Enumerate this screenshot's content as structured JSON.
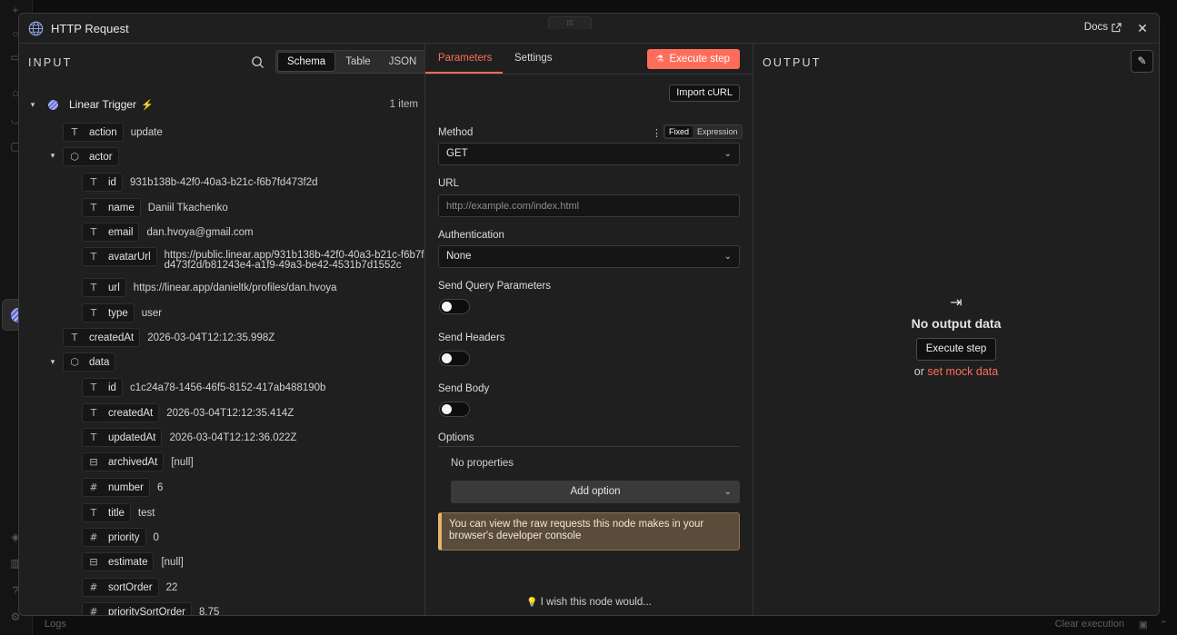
{
  "modal": {
    "title": "HTTP Request",
    "docs_label": "Docs"
  },
  "input": {
    "title": "INPUT",
    "view_tabs": [
      "Schema",
      "Table",
      "JSON"
    ],
    "trigger": {
      "label": "Linear Trigger",
      "count": "1 item"
    },
    "rows": [
      {
        "key": "action",
        "value": "update"
      },
      {
        "key": "actor"
      },
      {
        "key": "id",
        "value": "931b138b-42f0-40a3-b21c-f6b7fd473f2d"
      },
      {
        "key": "name",
        "value": "Daniil Tkachenko"
      },
      {
        "key": "email",
        "value": "dan.hvoya@gmail.com"
      },
      {
        "key": "avatarUrl",
        "value": "https://public.linear.app/931b138b-42f0-40a3-b21c-f6b7fd473f2d/b81243e4-a1f9-49a3-be42-4531b7d1552c"
      },
      {
        "key": "url",
        "value": "https://linear.app/danieltk/profiles/dan.hvoya"
      },
      {
        "key": "type",
        "value": "user"
      },
      {
        "key": "createdAt",
        "value": "2026-03-04T12:12:35.998Z"
      },
      {
        "key": "data"
      },
      {
        "key": "id",
        "value": "c1c24a78-1456-46f5-8152-417ab488190b"
      },
      {
        "key": "createdAt",
        "value": "2026-03-04T12:12:35.414Z"
      },
      {
        "key": "updatedAt",
        "value": "2026-03-04T12:12:36.022Z"
      },
      {
        "key": "archivedAt",
        "value": "[null]"
      },
      {
        "key": "number",
        "value": "6"
      },
      {
        "key": "title",
        "value": "test"
      },
      {
        "key": "priority",
        "value": "0"
      },
      {
        "key": "estimate",
        "value": "[null]"
      },
      {
        "key": "sortOrder",
        "value": "22"
      },
      {
        "key": "prioritySortOrder",
        "value": "8.75"
      }
    ]
  },
  "params": {
    "tabs": [
      "Parameters",
      "Settings"
    ],
    "execute_label": "Execute step",
    "import_label": "Import cURL",
    "method": {
      "label": "Method",
      "mode_fixed": "Fixed",
      "mode_expression": "Expression",
      "value": "GET"
    },
    "url": {
      "label": "URL",
      "placeholder": "http://example.com/index.html"
    },
    "auth": {
      "label": "Authentication",
      "value": "None"
    },
    "send_query": {
      "label": "Send Query Parameters"
    },
    "send_headers": {
      "label": "Send Headers"
    },
    "send_body": {
      "label": "Send Body"
    },
    "options": {
      "label": "Options",
      "empty": "No properties",
      "add_label": "Add option"
    },
    "notice": "You can view the raw requests this node makes in your browser's developer console",
    "wish": "I wish this node would..."
  },
  "output": {
    "title": "OUTPUT",
    "empty_title": "No output data",
    "execute_label": "Execute step",
    "or_text": "or",
    "mock_link": "set mock data"
  },
  "bottom": {
    "logs": "Logs",
    "clear": "Clear execution"
  },
  "colors": {
    "accent": "#ff6d5a",
    "panel": "#1f1f1f",
    "notice_bg": "#5a4c3a"
  }
}
